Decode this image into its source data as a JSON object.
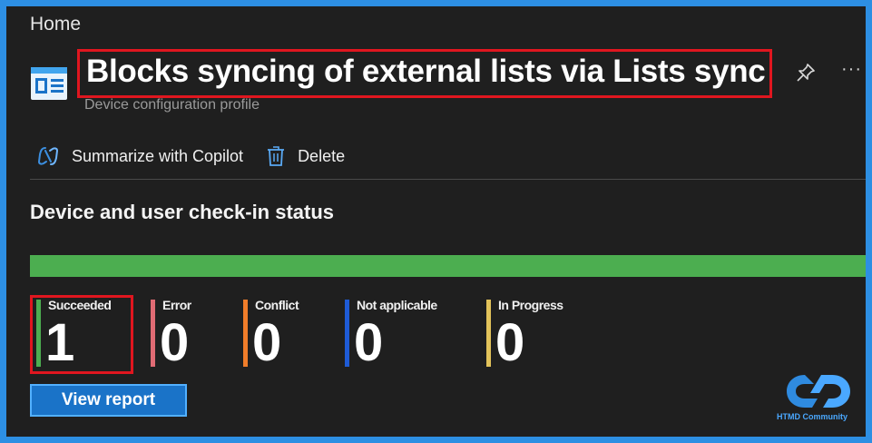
{
  "breadcrumb": {
    "home": "Home"
  },
  "header": {
    "title": "Blocks syncing of external lists via Lists sync",
    "subtitle": "Device configuration profile",
    "icon": "device-config-profile-icon"
  },
  "toolbar": {
    "summarize_label": "Summarize with Copilot",
    "delete_label": "Delete"
  },
  "section": {
    "title": "Device and user check-in status"
  },
  "progress": {
    "succeeded_fraction": 1.0,
    "color": "#4cae50"
  },
  "stats": [
    {
      "label": "Succeeded",
      "value": "1",
      "color": "#4cae50"
    },
    {
      "label": "Error",
      "value": "0",
      "color": "#e06b74"
    },
    {
      "label": "Conflict",
      "value": "0",
      "color": "#f07d2a"
    },
    {
      "label": "Not applicable",
      "value": "0",
      "color": "#1e5bd6"
    },
    {
      "label": "In Progress",
      "value": "0",
      "color": "#e2c35a"
    }
  ],
  "actions": {
    "view_report_label": "View report"
  },
  "watermark": {
    "text": "HTMD Community"
  },
  "colors": {
    "highlight": "#e0161f",
    "accent": "#1a73c8",
    "frame": "#2d8fe3"
  }
}
